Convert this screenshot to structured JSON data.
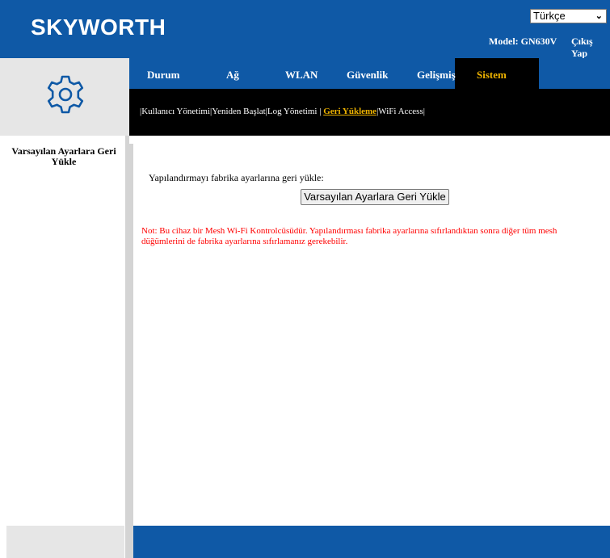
{
  "header": {
    "brand": "SKYWORTH",
    "language": {
      "selected": "Türkçe"
    },
    "model_label": "Model: GN630V",
    "logout_label": "Çıkış Yap"
  },
  "nav": {
    "tabs": [
      {
        "label": "Durum"
      },
      {
        "label": "Ağ"
      },
      {
        "label": "WLAN"
      },
      {
        "label": "Güvenlik"
      },
      {
        "label": "Gelişmiş"
      },
      {
        "label": "Sistem",
        "active": true
      }
    ],
    "subtabs": [
      {
        "label": "Kullanıcı Yönetimi"
      },
      {
        "label": "Yeniden Başlat"
      },
      {
        "label": "Log Yönetimi"
      },
      {
        "label": "Geri Yükleme",
        "active": true
      },
      {
        "label": "WiFi Access"
      }
    ]
  },
  "sidebar": {
    "items": [
      {
        "label": "Varsayılan Ayarlara Geri Yükle"
      }
    ]
  },
  "main": {
    "restore_label": "Yapılandırmayı fabrika ayarlarına geri yükle:",
    "restore_button": "Varsayılan Ayarlara Geri Yükle",
    "note": "Not: Bu cihaz bir Mesh Wi-Fi Kontrolcüsüdür. Yapılandırması fabrika ayarlarına sıfırlandıktan sonra diğer tüm mesh düğümlerini de fabrika ayarlarına sıfırlamanız gerekebilir."
  },
  "colors": {
    "brand_blue": "#0f59a6",
    "active_accent": "#f0b400",
    "note_red": "#ff0000"
  },
  "icons": {
    "logo_panel": "gear-icon",
    "dropdown": "chevron-down-icon"
  }
}
